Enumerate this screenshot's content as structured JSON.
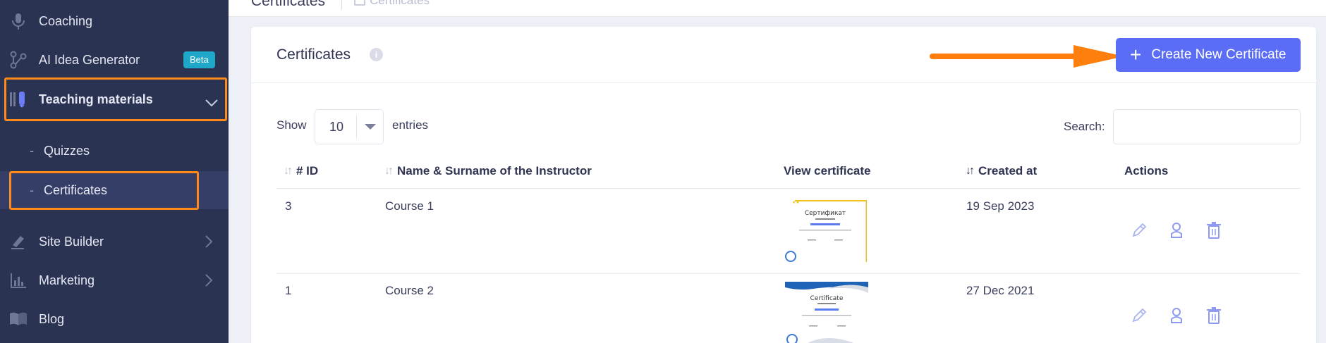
{
  "sidebar": {
    "items": [
      {
        "label": "Coaching",
        "icon": "microphone-icon"
      },
      {
        "label": "AI Idea Generator",
        "icon": "ai-nodes-icon",
        "badge": "Beta"
      },
      {
        "label": "Teaching materials",
        "icon": "book-pencil-icon",
        "expanded": true
      },
      {
        "label": "Site Builder",
        "icon": "brush-icon"
      },
      {
        "label": "Marketing",
        "icon": "bar-chart-icon"
      },
      {
        "label": "Blog",
        "icon": "open-book-icon"
      }
    ],
    "sub_items": [
      {
        "label": "Quizzes"
      },
      {
        "label": "Certificates",
        "active": true
      }
    ]
  },
  "topbar": {
    "title": "Certificates",
    "crumb": "Certificates"
  },
  "card": {
    "title": "Certificates",
    "create_button": "Create New Certificate"
  },
  "table_controls": {
    "show_label": "Show",
    "page_size": "10",
    "entries_label": "entries",
    "search_label": "Search:",
    "search_value": ""
  },
  "table": {
    "columns": [
      "# ID",
      "Name & Surname of the Instructor",
      "View certificate",
      "Created at",
      "Actions"
    ],
    "rows": [
      {
        "id": "3",
        "name": "Course 1",
        "created_at": "19 Sep 2023",
        "thumb": {
          "heading": "Сертификат"
        }
      },
      {
        "id": "1",
        "name": "Course 2",
        "created_at": "27 Dec 2021",
        "thumb": {
          "heading": "Certificate"
        }
      }
    ]
  },
  "colors": {
    "sidebar_bg": "#2a3352",
    "accent": "#5b6df5",
    "highlight": "#ff8a1a",
    "badge": "#1ea7c9"
  }
}
